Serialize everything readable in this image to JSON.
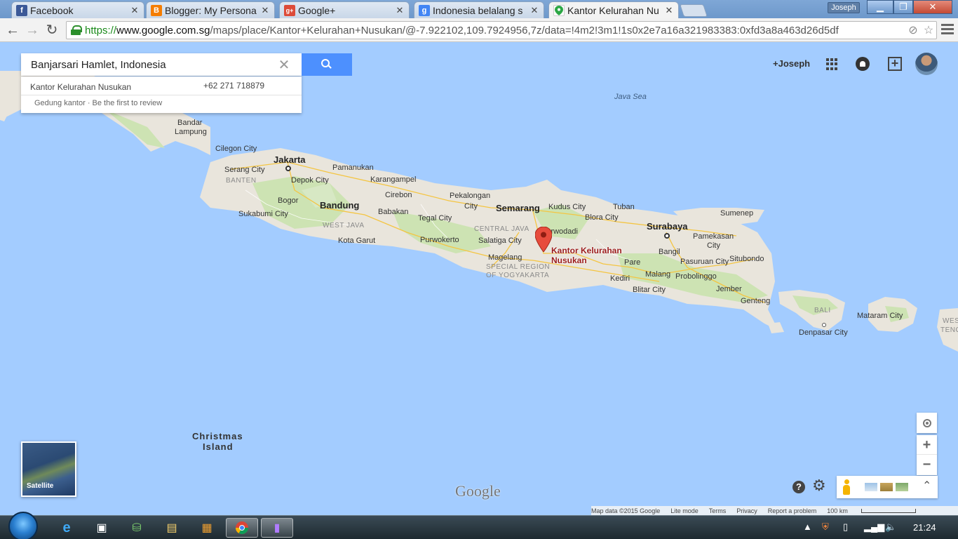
{
  "browser": {
    "tabs": [
      {
        "label": "Facebook",
        "favicon": "facebook-icon",
        "color": "#3b5998"
      },
      {
        "label": "Blogger: My Persona",
        "favicon": "blogger-icon",
        "color": "#f57d00"
      },
      {
        "label": "Google+",
        "favicon": "google-plus-icon",
        "color": "#dd4b39"
      },
      {
        "label": "Indonesia belalang s",
        "favicon": "google-search-icon",
        "color": "#4285f4"
      },
      {
        "label": "Kantor Kelurahan Nu",
        "favicon": "maps-icon",
        "color": "#2ca745"
      }
    ],
    "user_chip": "Joseph",
    "url": {
      "scheme": "https://",
      "host": "www.google.com.sg",
      "path": "/maps/place/Kantor+Kelurahan+Nusukan/@-7.922102,109.7924956,7z/data=!4m2!3m1!1s0x2e7a16a321983383:0xfd3a8a463d26d5df"
    }
  },
  "search": {
    "value": "Banjarsari Hamlet, Indonesia",
    "result_name": "Kantor Kelurahan Nusukan",
    "result_phone": "+62 271 718879",
    "result_sub": "Gedung kantor · Be the first to review"
  },
  "account": {
    "plus_user": "+Joseph"
  },
  "map": {
    "pin_label_line1": "Kantor Kelurahan",
    "pin_label_line2": "Nusukan",
    "labels": {
      "java_sea": "Java Sea",
      "bandar_lampung_1": "Bandar",
      "bandar_lampung_2": "Lampung",
      "cilegon": "Cilegon City",
      "jakarta": "Jakarta",
      "serang": "Serang City",
      "depok": "Depok City",
      "banten": "BANTEN",
      "pamanukan": "Pamanukan",
      "karangampel": "Karangampel",
      "bogor": "Bogor",
      "cirebon": "Cirebon",
      "bandung": "Bandung",
      "babakan": "Babakan",
      "pekalongan_1": "Pekalongan",
      "pekalongan_2": "City",
      "semarang": "Semarang",
      "kudus": "Kudus City",
      "tuban": "Tuban",
      "sukabumi": "Sukabumi City",
      "tegal": "Tegal City",
      "west_java": "WEST JAVA",
      "central_java": "CENTRAL JAVA",
      "purwodadi": "Purwodadi",
      "blora": "Blora City",
      "surabaya": "Surabaya",
      "sumenep": "Sumenep",
      "pamekasan_1": "Pamekasan",
      "pamekasan_2": "City",
      "kota_garut": "Kota Garut",
      "purwokerto": "Purwokerto",
      "salatiga": "Salatiga City",
      "magelang": "Magelang",
      "yogya_1": "SPECIAL REGION",
      "yogya_2": "OF YOGYAKARTA",
      "bangil": "Bangil",
      "pasuruan": "Pasuruan City",
      "situbondo": "Situbondo",
      "pare": "Pare",
      "malang": "Malang",
      "probolinggo": "Probolinggo",
      "kediri": "Kediri",
      "blitar": "Blitar City",
      "jember": "Jember",
      "genteng": "Genteng",
      "bali": "BALI",
      "mataram": "Mataram City",
      "denpasar": "Denpasar City",
      "west_nusa_1": "WES",
      "west_nusa_2": "TENG",
      "christmas_1": "Christmas",
      "christmas_2": "Island"
    },
    "satellite_label": "Satellite",
    "google_logo": "Google",
    "zoom_in": "+",
    "zoom_out": "−",
    "help": "?",
    "footer": {
      "map_data": "Map data ©2015 Google",
      "lite_mode": "Lite mode",
      "terms": "Terms",
      "privacy": "Privacy",
      "report": "Report a problem",
      "scale": "100 km"
    }
  },
  "taskbar": {
    "clock": "21:24"
  },
  "colors": {
    "water": "#a3ccff",
    "land": "#e9e5dc",
    "forest": "#cde3b3",
    "pin": "#e74c3c",
    "search_button": "#4d90fe"
  }
}
